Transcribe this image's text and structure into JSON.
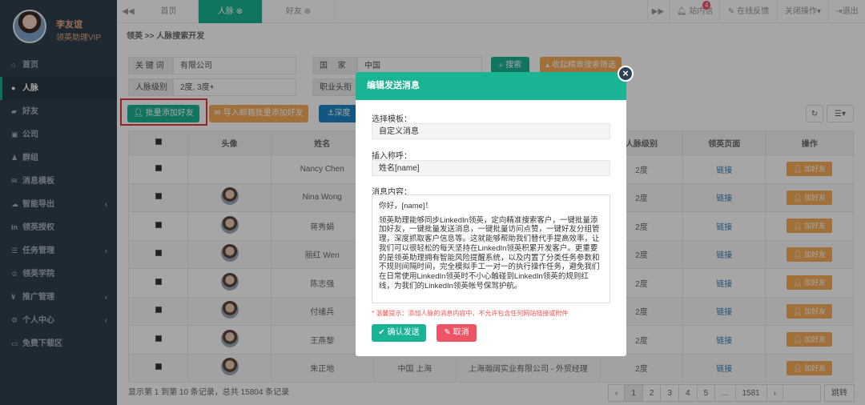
{
  "profile": {
    "name": "李友谊",
    "role": "领英助理VIP"
  },
  "sidebar": {
    "items": [
      {
        "label": "首页",
        "icon": "home-icon",
        "glyph": "⌂"
      },
      {
        "label": "人脉",
        "icon": "user-icon",
        "glyph": "●"
      },
      {
        "label": "好友",
        "icon": "chat-icon",
        "glyph": "▰"
      },
      {
        "label": "公司",
        "icon": "building-icon",
        "glyph": "▣"
      },
      {
        "label": "群组",
        "icon": "group-icon",
        "glyph": "♟"
      },
      {
        "label": "消息模板",
        "icon": "mail-icon",
        "glyph": "✉"
      },
      {
        "label": "智能导出",
        "icon": "cloud-icon",
        "glyph": "☁"
      },
      {
        "label": "领英授权",
        "icon": "linkedin-icon",
        "glyph": "in"
      },
      {
        "label": "任务管理",
        "icon": "list-icon",
        "glyph": "☰"
      },
      {
        "label": "领英学院",
        "icon": "graduation-icon",
        "glyph": "♔"
      },
      {
        "label": "推广管理",
        "icon": "yen-icon",
        "glyph": "¥"
      },
      {
        "label": "个人中心",
        "icon": "gear-icon",
        "glyph": "⚙"
      },
      {
        "label": "免费下载区",
        "icon": "card-icon",
        "glyph": "▭"
      }
    ]
  },
  "topbar": {
    "back": "◀◀",
    "tabs": [
      "首页",
      "人脉 ⊗",
      "好友 ⊗"
    ],
    "notify": "站内信",
    "notify_count": "4",
    "feedback": "在线反馈",
    "close_ops": "关闭操作▾",
    "logout": "退出",
    "next": "▶▶"
  },
  "breadcrumb": "领英 >> 人脉搜索开发",
  "filters": {
    "keyword_label": "关 键 词",
    "keyword_value": "有限公司",
    "country_label": "国　 家",
    "country_value": "中国",
    "level_label": "人脉级别",
    "level_value": "2度, 3度+",
    "title_label": "职业头衔",
    "search_btn": "搜索",
    "collapse_btn": "收起精准搜索筛选"
  },
  "actions": {
    "bulk_add": "批量添加好友",
    "import_email": "导入邮箱批量添加好友",
    "deep": "深度"
  },
  "table": {
    "headers": [
      "头像",
      "姓名",
      "人脉级别",
      "领英页面",
      "操作"
    ],
    "rows": [
      {
        "name": "Nancy Chen",
        "level": "2度",
        "link": "链接",
        "btn": "加好友"
      },
      {
        "name": "Nina Wong",
        "level": "2度",
        "link": "链接",
        "btn": "加好友"
      },
      {
        "name": "蒋秀娟",
        "level": "2度",
        "link": "链接",
        "btn": "加好友"
      },
      {
        "name": "丽红 Wen",
        "level": "2度",
        "link": "链接",
        "btn": "加好友"
      },
      {
        "name": "陈志强",
        "level": "2度",
        "link": "链接",
        "btn": "加好友"
      },
      {
        "name": "付绪兵",
        "level": "2度",
        "link": "链接",
        "btn": "加好友"
      },
      {
        "name": "王燕黎",
        "level": "2度",
        "link": "链接",
        "btn": "加好友"
      },
      {
        "name": "朱正地",
        "location": "中国 上海",
        "company": "上海瀚阔实业有限公司 - 外贸经理",
        "level": "2度",
        "link": "链接",
        "btn": "加好友"
      }
    ]
  },
  "footer": {
    "summary": "显示第 1 到第 10 条记录，总共 15804 条记录",
    "pages": [
      "‹",
      "1",
      "2",
      "3",
      "4",
      "5",
      "...",
      "1581",
      "›"
    ],
    "jump": "跳转"
  },
  "modal": {
    "title": "编辑发送消息",
    "template_label": "选择模板：",
    "template_value": "自定义消息",
    "salutation_label": "插入称呼：",
    "salutation_value": "姓名[name]",
    "content_label": "消息内容：",
    "content_greeting": "你好，[name]！",
    "content_body": "领英助理能够同步LinkedIn领英，定向精准搜索客户，一键批量添加好友，一键批量发送消息，一键批量访问点赞，一键好友分组管理，深度抓取客户信息等。这就能够帮助我们替代手提高效率，让我们可以很轻松的每天坚持在LinkedIn领英积累开发客户。更重要的是领英助理拥有智能风险提醒系统，以及内置了分类任务参数和不规则间隔时间，完全模拟手工一对一的执行操作任务，避免我们在日常使用LinkedIn领英时不小心触碰到LinkedIn领英的规则红线，为我们的LinkedIn领英帐号保驾护航。",
    "tip": "* 温馨提示：添加人脉的消息内容中，不允许包含任何网站链接或附件",
    "confirm": "✔ 确认发送",
    "cancel": "✎ 取消"
  }
}
